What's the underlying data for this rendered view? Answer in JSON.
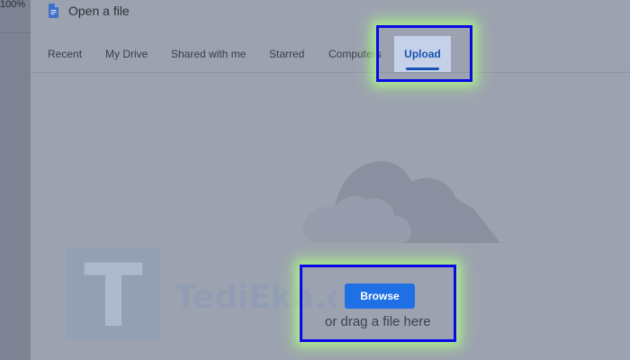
{
  "app": {
    "zoom_label": "100%"
  },
  "dialog": {
    "title": "Open a file",
    "tabs": [
      {
        "label": "Recent",
        "active": false
      },
      {
        "label": "My Drive",
        "active": false
      },
      {
        "label": "Shared with me",
        "active": false
      },
      {
        "label": "Starred",
        "active": false
      },
      {
        "label": "Computers",
        "active": false
      },
      {
        "label": "Upload",
        "active": true
      }
    ],
    "upload": {
      "browse_label": "Browse",
      "drag_text": "or drag a file here"
    }
  },
  "watermark": {
    "letter": "T",
    "text": "TediEka.com"
  },
  "colors": {
    "accent": "#1a52b3",
    "button": "#1f6fe5",
    "highlight_border": "#0a0ae8",
    "highlight_glow": "#aaf08c",
    "overlay": "#9ca2b0"
  }
}
